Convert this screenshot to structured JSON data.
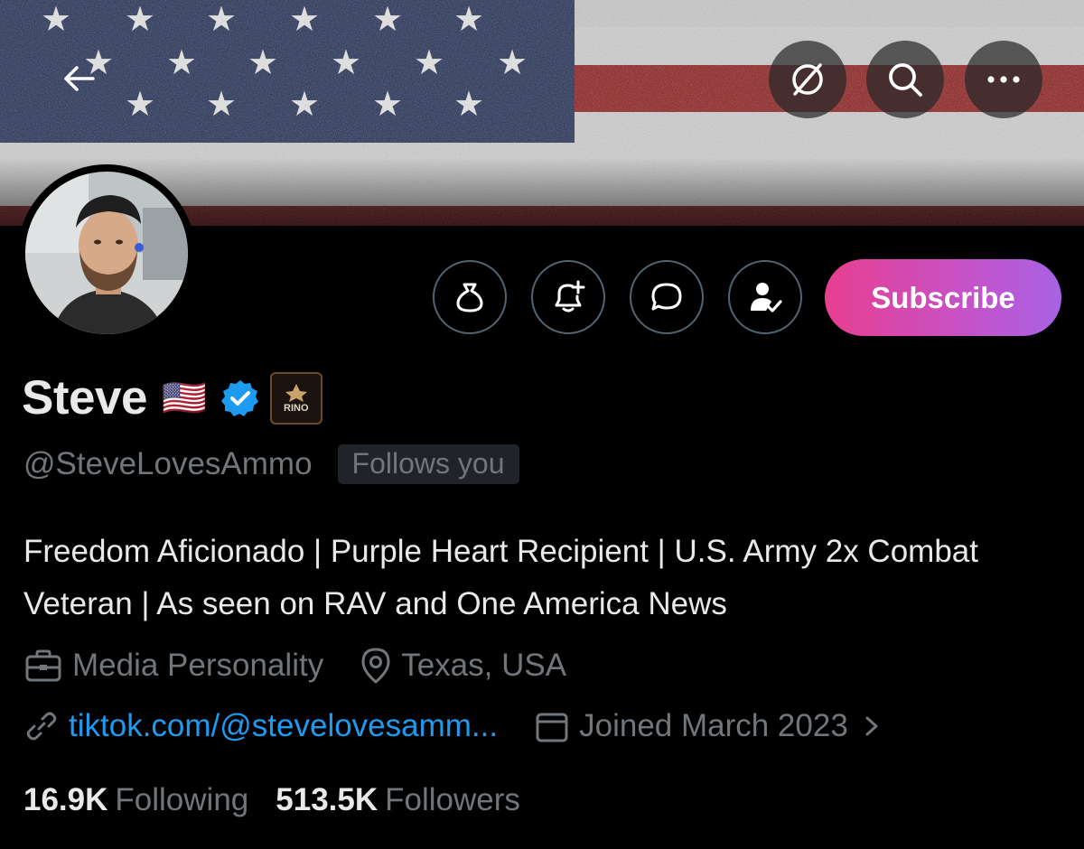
{
  "header": {
    "back_icon": "arrow-left-icon",
    "icons": [
      "grok-icon",
      "search-icon",
      "more-icon"
    ]
  },
  "profile": {
    "name": "Steve",
    "name_emoji": "🇺🇸",
    "badge_text": "RINO",
    "handle": "@SteveLovesAmmo",
    "follows_you": "Follows you",
    "bio": "Freedom Aficionado | Purple Heart Recipient | U.S. Army 2x Combat Veteran | As seen on RAV and One America News",
    "category": "Media Personality",
    "location": "Texas, USA",
    "website": "tiktok.com/@stevelovesamm...",
    "joined": "Joined March 2023"
  },
  "actions": {
    "subscribe_label": "Subscribe",
    "icons": [
      "tip-bag-icon",
      "notification-bell-plus-icon",
      "message-bubble-icon",
      "following-check-icon"
    ]
  },
  "stats": {
    "following_count": "16.9K",
    "following_label": "Following",
    "followers_count": "513.5K",
    "followers_label": "Followers"
  },
  "colors": {
    "background": "#000000",
    "text": "#e7e9ea",
    "muted": "#71767b",
    "link": "#1d9bf0",
    "verified": "#1d9bf0",
    "subscribe_start": "#e73f8f",
    "subscribe_end": "#a862e4"
  }
}
